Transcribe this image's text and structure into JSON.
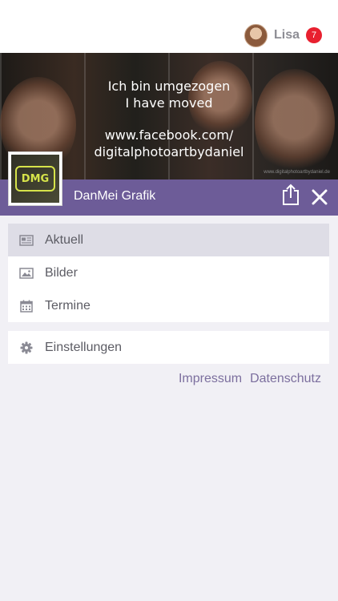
{
  "header": {
    "user_name": "Lisa",
    "notification_count": "7"
  },
  "hero": {
    "lines": [
      "Ich bin umgezogen",
      "I have moved",
      "",
      "www.facebook.com/",
      "digitalphotoartbydaniel"
    ],
    "watermark": "www.digitalphotoartbydaniel.de"
  },
  "brand": {
    "name": "DanMei Grafik",
    "logo_text": "DMG"
  },
  "menu": {
    "items": [
      {
        "label": "Aktuell",
        "icon": "newspaper-icon",
        "active": true
      },
      {
        "label": "Bilder",
        "icon": "image-icon",
        "active": false
      },
      {
        "label": "Termine",
        "icon": "calendar-icon",
        "active": false
      }
    ],
    "settings": {
      "label": "Einstellungen",
      "icon": "gear-icon"
    }
  },
  "footer": {
    "impressum": "Impressum",
    "datenschutz": "Datenschutz"
  },
  "colors": {
    "accent": "#6d5c98",
    "badge": "#e8202f",
    "active_row": "#dedde6",
    "link": "#7c6f9e"
  }
}
